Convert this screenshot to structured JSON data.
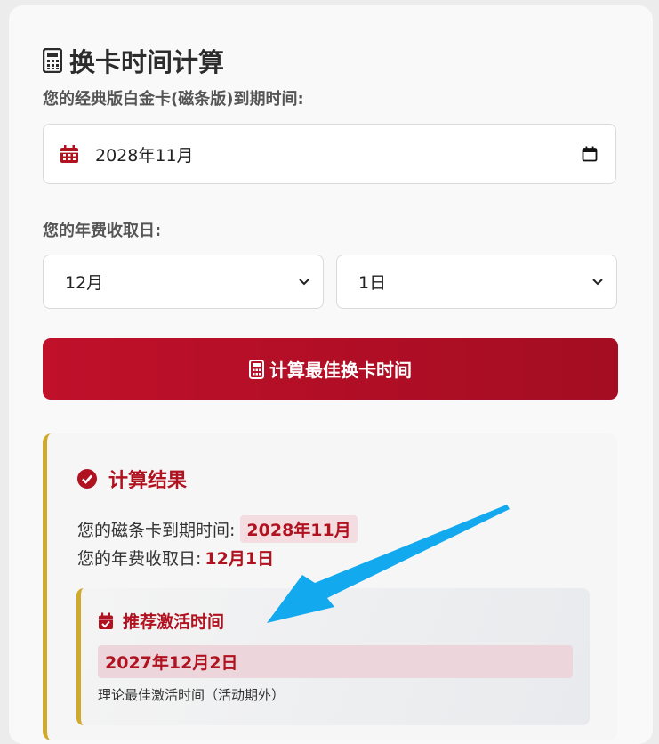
{
  "header": {
    "title": "换卡时间计算"
  },
  "form": {
    "expiry_label": "您的经典版白金卡(磁条版)到期时间:",
    "expiry_value": "2028年11月",
    "fee_label": "您的年费收取日:",
    "month_selected": "12月",
    "day_selected": "1日",
    "calculate_button": "计算最佳换卡时间"
  },
  "result": {
    "heading": "计算结果",
    "expiry_prefix": "您的磁条卡到期时间:",
    "expiry_value": "2028年11月",
    "fee_prefix": "您的年费收取日:",
    "fee_value": "12月1日",
    "recommend": {
      "heading": "推荐激活时间",
      "date": "2027年12月2日",
      "note": "理论最佳激活时间（活动期外）"
    }
  },
  "colors": {
    "accent_red": "#b1121f",
    "gold_border": "#d2aa2b",
    "annotation_arrow": "#13a9ef"
  },
  "icons": [
    "calculator-icon",
    "calendar-icon",
    "chevron-down-icon",
    "check-circle-icon",
    "calendar-check-icon"
  ]
}
